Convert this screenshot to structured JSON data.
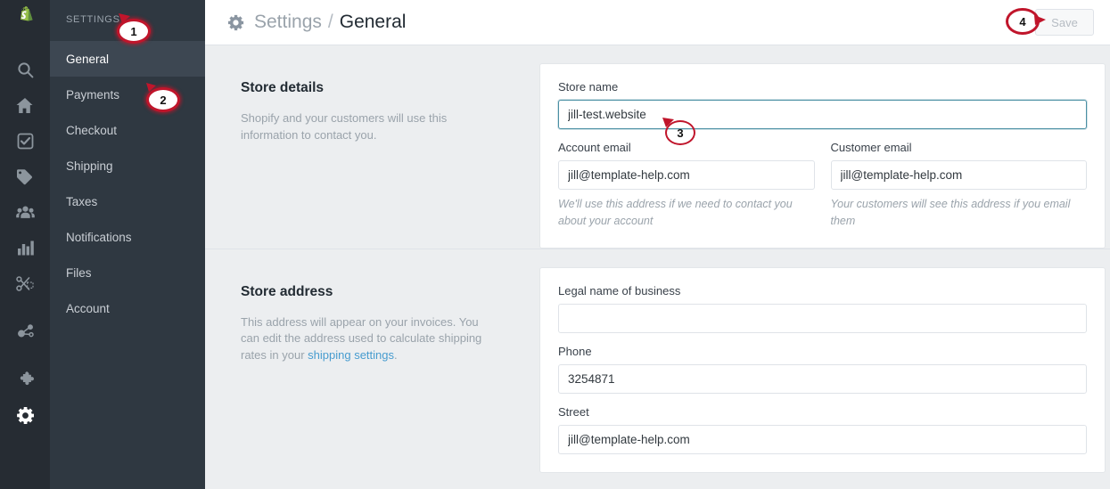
{
  "rail": {
    "logo": "shopify-logo",
    "icons": [
      {
        "name": "search-icon",
        "label": "Search"
      },
      {
        "name": "home-icon",
        "label": "Home"
      },
      {
        "name": "orders-icon",
        "label": "Orders"
      },
      {
        "name": "products-tag-icon",
        "label": "Products"
      },
      {
        "name": "customers-icon",
        "label": "Customers"
      },
      {
        "name": "reports-bar-chart-icon",
        "label": "Reports"
      },
      {
        "name": "discounts-scissors-icon",
        "label": "Discounts"
      },
      {
        "name": "sales-channels-icon",
        "label": "Sales channels"
      },
      {
        "name": "apps-puzzle-icon",
        "label": "Apps"
      },
      {
        "name": "settings-gear-icon",
        "label": "Settings"
      }
    ]
  },
  "sidebar": {
    "title": "SETTINGS",
    "items": [
      {
        "label": "General"
      },
      {
        "label": "Payments"
      },
      {
        "label": "Checkout"
      },
      {
        "label": "Shipping"
      },
      {
        "label": "Taxes"
      },
      {
        "label": "Notifications"
      },
      {
        "label": "Files"
      },
      {
        "label": "Account"
      }
    ]
  },
  "topbar": {
    "gear_icon": "gear-icon",
    "breadcrumb_parent": "Settings",
    "breadcrumb_separator": "/",
    "breadcrumb_current": "General",
    "save_label": "Save"
  },
  "store_details": {
    "title": "Store details",
    "description": "Shopify and your customers will use this information to contact you.",
    "store_name_label": "Store name",
    "store_name_value": "jill-test.website",
    "account_email_label": "Account email",
    "account_email_value": "jill@template-help.com",
    "account_email_help": "We'll use this address if we need to contact you about your account",
    "customer_email_label": "Customer email",
    "customer_email_value": "jill@template-help.com",
    "customer_email_help": "Your customers will see this address if you email them"
  },
  "store_address": {
    "title": "Store address",
    "description_part1": "This address will appear on your invoices. You can edit the address used to calculate shipping rates in your ",
    "description_link": "shipping settings",
    "description_part2": ".",
    "legal_name_label": "Legal name of business",
    "legal_name_value": "",
    "phone_label": "Phone",
    "phone_value": "3254871",
    "street_label": "Street",
    "street_value": "jill@template-help.com"
  },
  "annotations": [
    {
      "id": "1",
      "text": "1"
    },
    {
      "id": "2",
      "text": "2"
    },
    {
      "id": "3",
      "text": "3"
    },
    {
      "id": "4",
      "text": "4"
    }
  ],
  "colors": {
    "rail_bg": "#262c33",
    "sidebar_bg": "#2f3841",
    "sidebar_active": "#3d4752",
    "content_bg": "#eceef0",
    "card_bg": "#ffffff",
    "accent_link": "#479ccf",
    "focus_border": "#4a8fa3",
    "annotation_red": "#c0152b",
    "shopify_green": "#95bf47"
  }
}
